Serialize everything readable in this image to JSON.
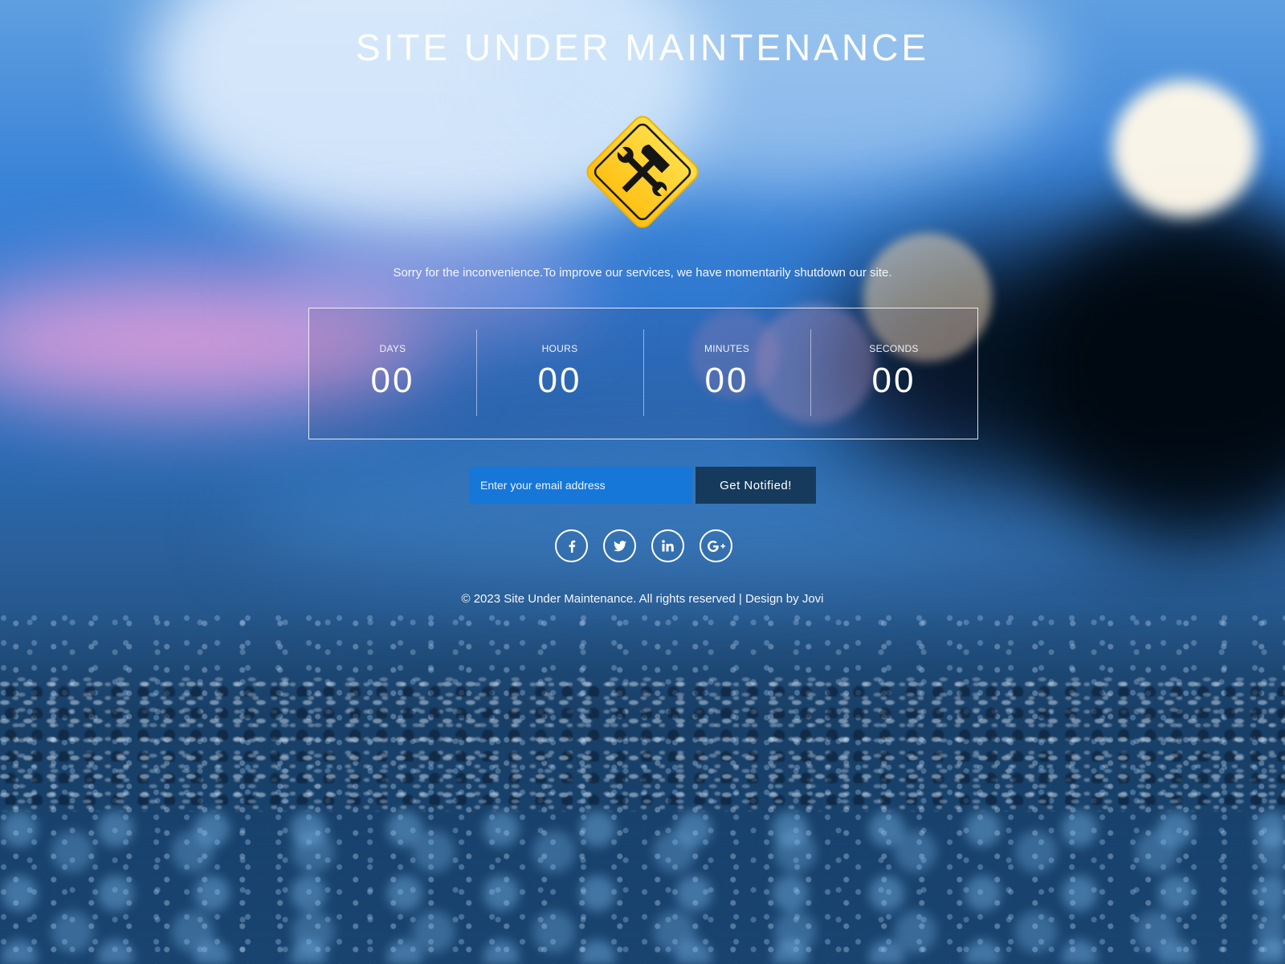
{
  "page": {
    "title": "SITE UNDER MAINTENANCE",
    "sign_icon": "maintenance-sign-icon",
    "message": "Sorry for the inconvenience.To improve our services, we have momentarily shutdown our site."
  },
  "countdown": [
    {
      "label": "DAYS",
      "value": "00"
    },
    {
      "label": "HOURS",
      "value": "00"
    },
    {
      "label": "MINUTES",
      "value": "00"
    },
    {
      "label": "SECONDS",
      "value": "00"
    }
  ],
  "subscribe": {
    "placeholder": "Enter your email address",
    "value": "",
    "button_label": "Get Notified!"
  },
  "socials": [
    {
      "icon": "facebook-icon"
    },
    {
      "icon": "twitter-icon"
    },
    {
      "icon": "linkedin-icon"
    },
    {
      "icon": "google-plus-icon"
    }
  ],
  "footer": {
    "text": "© 2023 Site Under Maintenance. All rights reserved | Design by Jovi"
  },
  "colors": {
    "accent_input": "#1677d9",
    "button_bg": "#163a5c",
    "sign_yellow": "#ffc926",
    "text": "#ffffff"
  }
}
